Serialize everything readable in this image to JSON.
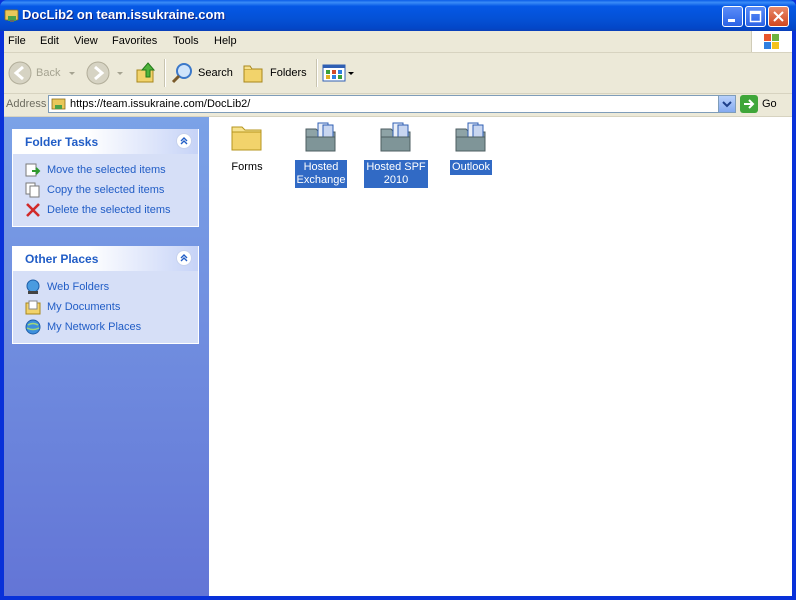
{
  "window": {
    "title": "DocLib2 on team.issukraine.com",
    "colors": {
      "titlebar": "#0558e6",
      "selection": "#316ac5",
      "task_link": "#215dc6"
    }
  },
  "menu": [
    "File",
    "Edit",
    "View",
    "Favorites",
    "Tools",
    "Help"
  ],
  "toolbar": {
    "back_label": "Back",
    "search_label": "Search",
    "folders_label": "Folders"
  },
  "address": {
    "label": "Address",
    "value": "https://team.issukraine.com/DocLib2/",
    "go_label": "Go"
  },
  "folder_tasks": {
    "title": "Folder Tasks",
    "items": [
      {
        "label": "Move the selected items",
        "icon": "move-icon"
      },
      {
        "label": "Copy the selected items",
        "icon": "copy-icon"
      },
      {
        "label": "Delete the selected items",
        "icon": "delete-icon"
      }
    ]
  },
  "other_places": {
    "title": "Other Places",
    "items": [
      {
        "label": "Web Folders",
        "icon": "web-folders-icon"
      },
      {
        "label": "My Documents",
        "icon": "my-documents-icon"
      },
      {
        "label": "My Network Places",
        "icon": "network-places-icon"
      }
    ]
  },
  "folders": [
    {
      "line1": "Forms",
      "line2": "",
      "selected": false,
      "type": "folder"
    },
    {
      "line1": "Hosted",
      "line2": "Exchange",
      "selected": true,
      "type": "web-folder"
    },
    {
      "line1": "Hosted SPF",
      "line2": "2010",
      "selected": true,
      "type": "web-folder"
    },
    {
      "line1": "Outlook",
      "line2": "",
      "selected": true,
      "type": "web-folder"
    }
  ]
}
